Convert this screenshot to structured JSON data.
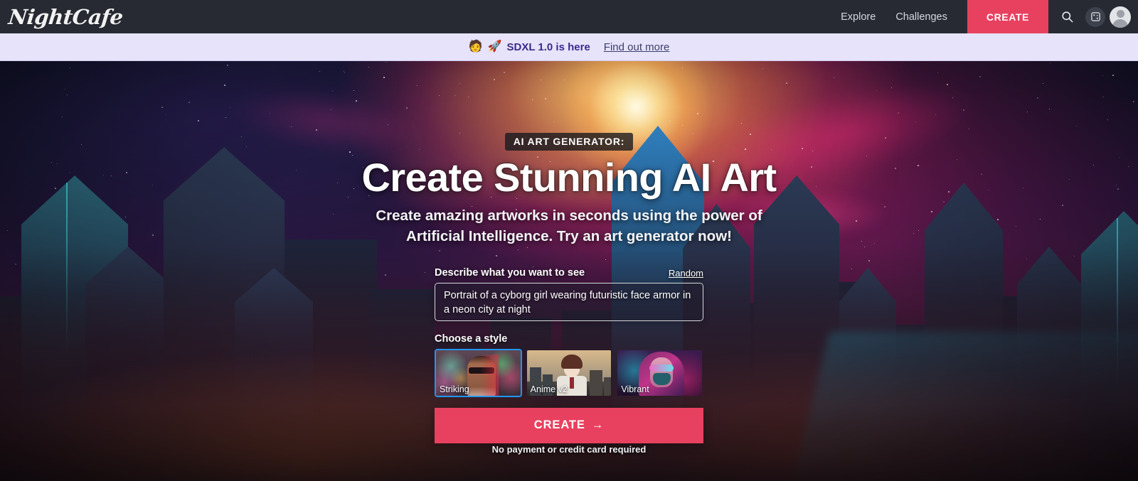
{
  "header": {
    "logo_text": "NightCafe",
    "nav": [
      {
        "label": "Explore"
      },
      {
        "label": "Challenges"
      }
    ],
    "create_label": "CREATE",
    "icons": {
      "search": "search-icon",
      "dice": "dice-icon",
      "avatar": "avatar-icon"
    }
  },
  "announcement": {
    "emoji_person": "🧑",
    "emoji_rocket": "🚀",
    "text": "SDXL 1.0 is here",
    "link_label": "Find out more"
  },
  "hero": {
    "eyebrow": "AI ART GENERATOR:",
    "title": "Create Stunning AI Art",
    "subtitle": "Create amazing artworks in seconds using the power of Artificial Intelligence. Try an art generator now!"
  },
  "form": {
    "prompt_label": "Describe what you want to see",
    "random_label": "Random",
    "prompt_value": "Portrait of a cyborg girl wearing futuristic face armor in a neon city at night",
    "prompt_placeholder": "Describe what you want to see",
    "style_label": "Choose a style",
    "styles": [
      {
        "label": "Striking",
        "selected": true
      },
      {
        "label": "Anime v2",
        "selected": false
      },
      {
        "label": "Vibrant",
        "selected": false
      }
    ],
    "submit_label": "CREATE",
    "submit_arrow": "→",
    "footnote": "No payment or credit card required"
  },
  "colors": {
    "accent_pink": "#e8415f",
    "header_bg": "#272a33",
    "banner_bg": "#e7e3fa",
    "banner_text": "#3b2a8c",
    "selected_border": "#2196f3"
  }
}
